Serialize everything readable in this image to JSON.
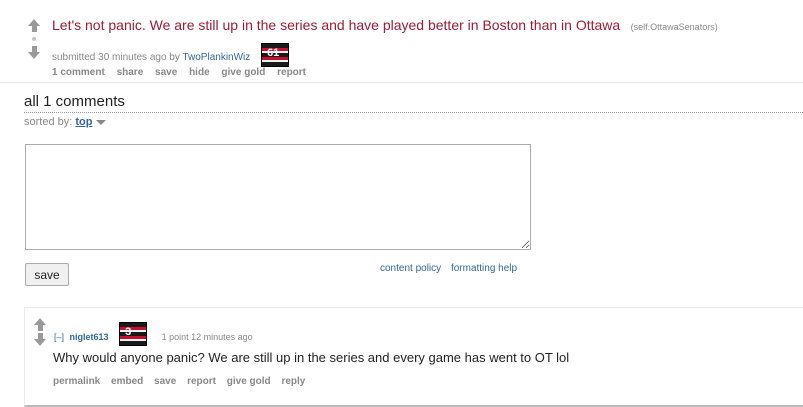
{
  "post": {
    "title": "Let's not panic. We are still up in the series and have played better in Boston than in Ottawa",
    "domain": "(self.OttawaSenators)",
    "submitted_prefix": "submitted 30 minutes ago by",
    "author": "TwoPlankinWiz",
    "author_flair": "61",
    "buttons": [
      "1 comment",
      "share",
      "save",
      "hide",
      "give gold",
      "report"
    ]
  },
  "comments_panel": {
    "title": "all 1 comments",
    "sorted_by_label": "sorted by:",
    "sorted_by_value": "top",
    "textarea_value": "",
    "save_label": "save",
    "help_links": [
      "content policy",
      "formatting help"
    ]
  },
  "comment": {
    "collapse": "[–]",
    "author": "niglet613",
    "author_flair": "3",
    "meta": "1 point 12 minutes ago",
    "body": "Why would anyone panic? We are still up in the series and every game has went to OT lol",
    "buttons": [
      "permalink",
      "embed",
      "save",
      "report",
      "give gold",
      "reply"
    ]
  },
  "colors": {
    "title": "#9c1b36",
    "link": "#336699",
    "meta": "#888888"
  }
}
